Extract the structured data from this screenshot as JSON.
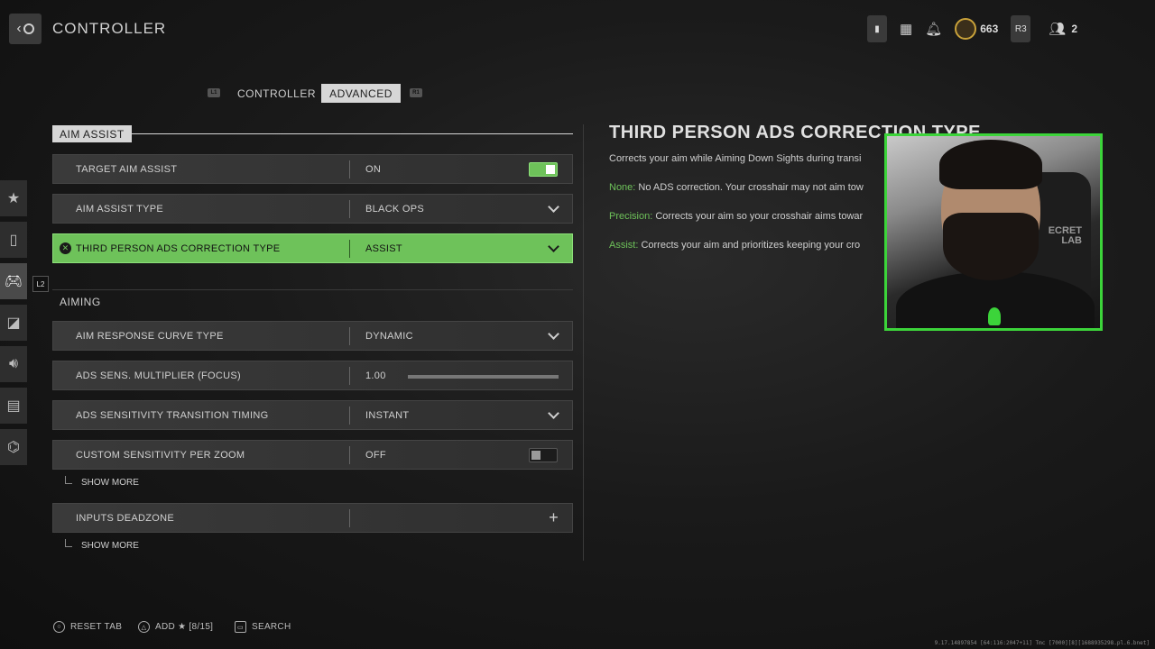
{
  "header": {
    "title": "CONTROLLER",
    "currency_count": "663",
    "rank_badge": "R3",
    "party_count": "2"
  },
  "tabs": {
    "left_hint": "L1",
    "right_hint": "R1",
    "items": [
      {
        "label": "CONTROLLER",
        "active": false
      },
      {
        "label": "ADVANCED",
        "active": true
      }
    ]
  },
  "nav_badge": "L2",
  "sections": {
    "aim_assist": {
      "title": "AIM ASSIST",
      "rows": [
        {
          "label": "TARGET AIM ASSIST",
          "value": "ON",
          "control": "toggle-on"
        },
        {
          "label": "AIM ASSIST TYPE",
          "value": "BLACK OPS",
          "control": "dropdown"
        },
        {
          "label": "THIRD PERSON ADS CORRECTION TYPE",
          "value": "ASSIST",
          "control": "dropdown",
          "selected": true
        }
      ]
    },
    "aiming": {
      "title": "AIMING",
      "rows": [
        {
          "label": "AIM RESPONSE CURVE TYPE",
          "value": "DYNAMIC",
          "control": "dropdown"
        },
        {
          "label": "ADS SENS. MULTIPLIER (FOCUS)",
          "value": "1.00",
          "control": "slider"
        },
        {
          "label": "ADS SENSITIVITY TRANSITION TIMING",
          "value": "INSTANT",
          "control": "dropdown"
        },
        {
          "label": "CUSTOM SENSITIVITY PER ZOOM",
          "value": "OFF",
          "control": "toggle-off"
        }
      ],
      "show_more_1": "SHOW MORE",
      "deadzone_label": "INPUTS DEADZONE",
      "show_more_2": "SHOW MORE"
    }
  },
  "description": {
    "title": "THIRD PERSON ADS CORRECTION TYPE",
    "intro": "Corrects your aim while Aiming Down Sights during transi",
    "options": [
      {
        "key": "None:",
        "text": " No ADS correction. Your crosshair may not aim tow"
      },
      {
        "key": "Precision:",
        "text": " Corrects your aim so your crosshair aims towar"
      },
      {
        "key": "Assist:",
        "text": " Corrects your aim and prioritizes keeping your cro"
      }
    ]
  },
  "webcam": {
    "chair_text_1": "ECRET",
    "chair_text_2": "LAB"
  },
  "footer": {
    "reset_tab": "RESET TAB",
    "add_favorite": "ADD ★ [8/15]",
    "search": "SEARCH",
    "build_info": "9.17.14897854 [64:116:2047+11] Tmc [7000][8][1688935298.pl.6.bnet]"
  },
  "colors": {
    "accent_green": "#6ec25a",
    "webcam_border": "#3cd43a"
  }
}
